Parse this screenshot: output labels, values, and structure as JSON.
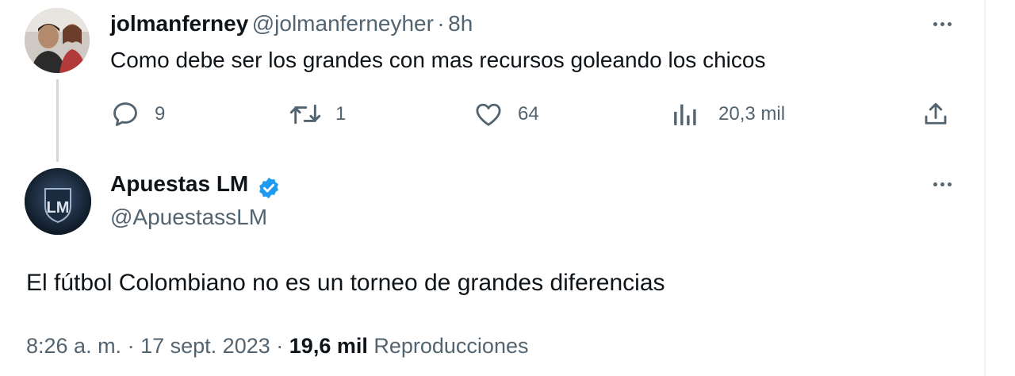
{
  "reply": {
    "display_name": "jolmanferney",
    "handle": "@jolmanferneyher",
    "separator": "·",
    "time": "8h",
    "text": "Como debe ser los grandes con mas recursos goleando los chicos",
    "actions": {
      "replies": "9",
      "retweets": "1",
      "likes": "64",
      "views": "20,3 mil"
    }
  },
  "original": {
    "display_name": "Apuestas LM",
    "handle": "@ApuestassLM",
    "text": "El fútbol Colombiano no es un torneo de grandes diferencias",
    "time": "8:26 a. m.",
    "separator": "·",
    "date": "17 sept. 2023",
    "views_count": "19,6 mil",
    "views_label": "Reproducciones",
    "avatar_text": "LM"
  },
  "colors": {
    "text_primary": "#0f1419",
    "text_secondary": "#536471",
    "verified_blue": "#1d9bf0",
    "thread_line": "#cfd9de"
  },
  "icons": [
    "reply-icon",
    "retweet-icon",
    "like-icon",
    "views-icon",
    "share-icon",
    "more-icon",
    "verified-badge-icon"
  ]
}
